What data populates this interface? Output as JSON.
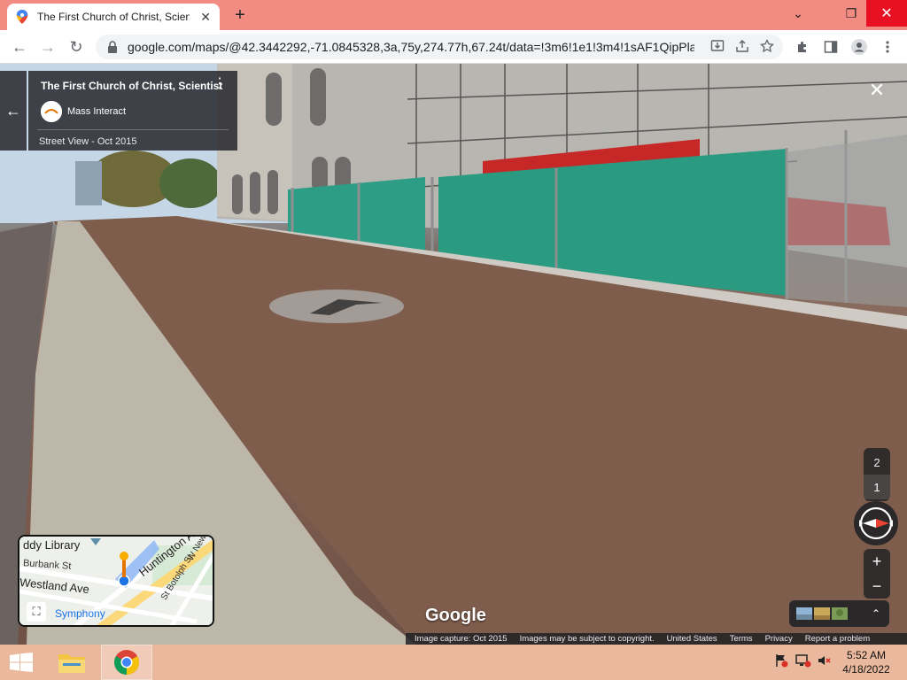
{
  "browser": {
    "tab_title": "The First Church of Christ, Scientist",
    "tab_close": "✕",
    "new_tab": "+",
    "url": "google.com/maps/@42.3442292,-71.0845328,3a,75y,274.77h,67.24t/data=!3m6!1e1!3m4!1sAF1QipPla...",
    "window": {
      "minimize": "⌄",
      "maximize": "❐",
      "close": "✕"
    },
    "nav": {
      "back": "←",
      "forward": "→",
      "reload": "↻"
    }
  },
  "streetview": {
    "place_name": "The First Church of Christ, Scientist",
    "menu": "⋮",
    "author": "Mass Interact",
    "date": "Street View - Oct 2015",
    "back": "←",
    "close": "✕",
    "minimap": {
      "labels": {
        "library": "ddy Library",
        "burbank": "Burbank St",
        "huntington": "Huntington Ave",
        "newton": "W Newt",
        "westland": "Westland Ave",
        "boloph": "St Botolph St",
        "symphony": "Symphony"
      },
      "expand": "⛶"
    },
    "floors": [
      "2",
      "1"
    ],
    "active_floor": "1",
    "zoom_in": "+",
    "zoom_out": "−",
    "photos_toggle": "⌃",
    "watermark": "Google",
    "attribution": [
      "Image capture: Oct 2015",
      "Images may be subject to copyright.",
      "United States",
      "Terms",
      "Privacy",
      "Report a problem"
    ]
  },
  "taskbar": {
    "time": "5:52 AM",
    "date": "4/18/2022"
  },
  "colors": {
    "tabbar": "#f28b82",
    "taskbar": "#e9b89d",
    "accent": "#1a73e8",
    "close_red": "#e81123"
  }
}
